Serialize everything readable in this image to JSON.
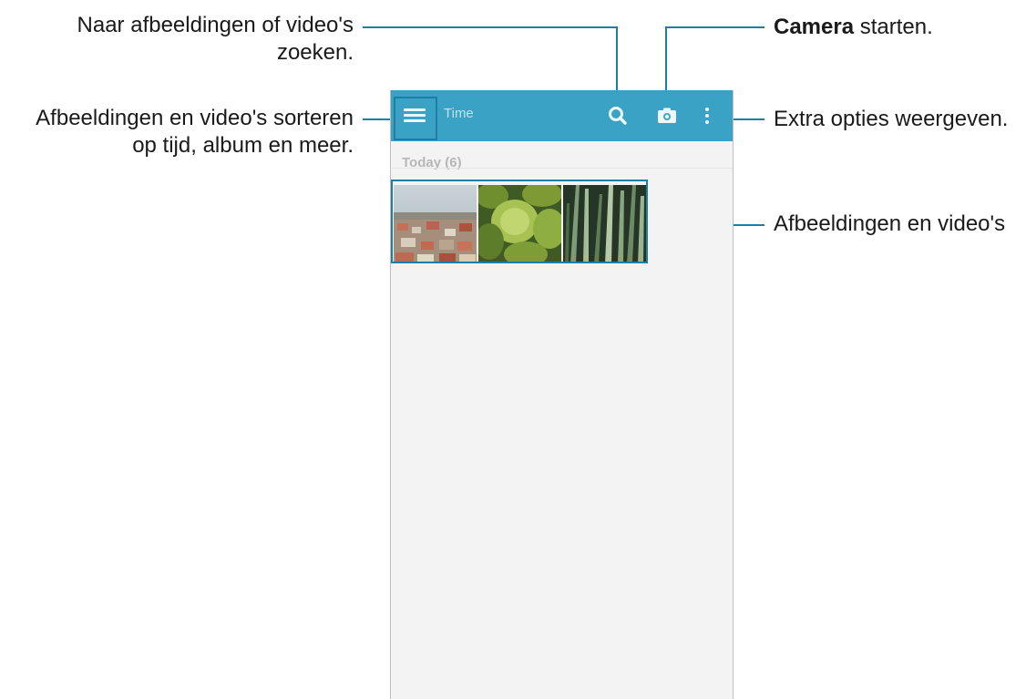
{
  "callouts": {
    "search": {
      "line1": "Naar afbeeldingen of video's",
      "line2": "zoeken."
    },
    "sort": {
      "line1": "Afbeeldingen en video's sorteren",
      "line2": "op tijd, album en meer."
    },
    "camera": {
      "bold": "Camera",
      "rest": " starten."
    },
    "options": {
      "text": "Extra opties weergeven."
    },
    "media": {
      "text": "Afbeeldingen en video's"
    }
  },
  "screen": {
    "title": "Time",
    "section_header": "Today (6)",
    "thumbnails": [
      {
        "name": "city-thumbnail"
      },
      {
        "name": "plant-thumbnail"
      },
      {
        "name": "grass-thumbnail"
      }
    ]
  },
  "icons": {
    "menu": "menu-icon",
    "search": "search-icon",
    "camera": "camera-icon",
    "more": "more-options-icon"
  },
  "colors": {
    "accent": "#1e7fa6",
    "action_bar": "#3aa3c5",
    "background": "#f3f3f3"
  }
}
